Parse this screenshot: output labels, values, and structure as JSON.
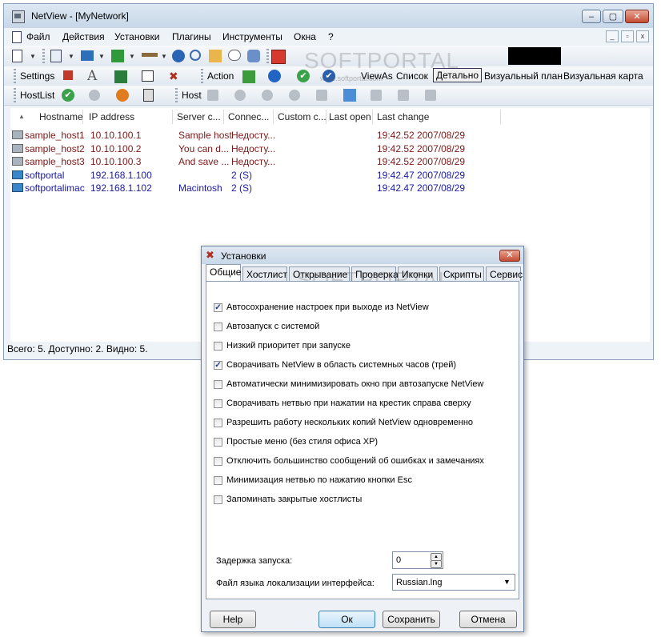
{
  "window": {
    "title": "NetView - [MyNetwork]"
  },
  "menu": [
    "Файл",
    "Действия",
    "Установки",
    "Плагины",
    "Инструменты",
    "Окна",
    "?"
  ],
  "toolbar2": {
    "settings_label": "Settings",
    "action_label": "Action",
    "viewas_label": "ViewAs",
    "views": [
      "Список",
      "Детально",
      "Визуальный план",
      "Визуальная карта"
    ],
    "active_view": "Детально"
  },
  "toolbar3": {
    "hostlist_label": "HostList",
    "host_label": "Host"
  },
  "list": {
    "columns": [
      "Hostname",
      "IP address",
      "Server c...",
      "Connec...",
      "Custom c...",
      "Last open",
      "Last change"
    ],
    "rows": [
      {
        "hostname": "sample_host1",
        "ip": "10.10.100.1",
        "server": "Sample host",
        "conn": "Недосту...",
        "last_change": "19:42.52 2007/08/29",
        "color": "#7a1a1a"
      },
      {
        "hostname": "sample_host2",
        "ip": "10.10.100.2",
        "server": "You can d...",
        "conn": "Недосту...",
        "last_change": "19:42.52 2007/08/29",
        "color": "#7a1a1a"
      },
      {
        "hostname": "sample_host3",
        "ip": "10.10.100.3",
        "server": "And save ...",
        "conn": "Недосту...",
        "last_change": "19:42.52 2007/08/29",
        "color": "#7a1a1a"
      },
      {
        "hostname": "softportal",
        "ip": "192.168.1.100",
        "server": "",
        "conn": "2 (S)",
        "last_change": "19:42.47 2007/08/29",
        "color": "#1a1aa0"
      },
      {
        "hostname": "softportalimac",
        "ip": "192.168.1.102",
        "server": "Macintosh",
        "conn": "2 (S)",
        "last_change": "19:42.47 2007/08/29",
        "color": "#1a1aa0"
      }
    ]
  },
  "statusbar": "Всего: 5. Доступно: 2. Видно: 5.",
  "dialog": {
    "title": "Установки",
    "tabs": [
      "Общие",
      "Хостлист",
      "Открывание",
      "Проверка",
      "Иконки",
      "Скрипты",
      "Сервис"
    ],
    "options": [
      {
        "label": "Автосохранение настроек при выходе из NetView",
        "checked": true
      },
      {
        "label": "Автозапуск с системой",
        "checked": false
      },
      {
        "label": "Низкий приоритет при запуске",
        "checked": false
      },
      {
        "label": "Сворачивать NetView в область системных часов (трей)",
        "checked": true
      },
      {
        "label": "Автоматически минимизировать окно при автозапуске NetView",
        "checked": false
      },
      {
        "label": "Сворачивать нетвью при нажатии на крестик справа сверху",
        "checked": false
      },
      {
        "label": "Разрешить работу нескольких копий NetView одновременно",
        "checked": false
      },
      {
        "label": "Простые меню (без стиля офиса XP)",
        "checked": false
      },
      {
        "label": "Отключить большинство сообщений об ошибках и замечаниях",
        "checked": false
      },
      {
        "label": "Минимизация нетвью по нажатию кнопки Esc",
        "checked": false
      },
      {
        "label": "Запоминать закрытые хостлисты",
        "checked": false
      }
    ],
    "delay_label": "Задержка запуска:",
    "delay_value": "0",
    "lang_label": "Файл языка локализации интерфейса:",
    "lang_value": "Russian.lng",
    "buttons": {
      "help": "Help",
      "ok": "Ок",
      "save": "Сохранить",
      "cancel": "Отмена"
    }
  },
  "watermark": {
    "text": "SOFTPORTAL",
    "url": "www.softportal.com"
  }
}
